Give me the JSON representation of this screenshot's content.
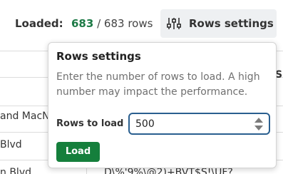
{
  "toolbar": {
    "loaded_label": "Loaded:",
    "loaded_count": "683",
    "loaded_total": "/ 683 rows",
    "rows_settings_label": "Rows settings",
    "settings_icon": "sliders-icon"
  },
  "table": {
    "rows": [
      {
        "col1": "and MacN",
        "col2": ""
      },
      {
        "col1": "Blvd",
        "col2": ""
      },
      {
        "col1": "n Blvd",
        "col2": "D\\%'9%\\@2)+BVT$S!\\UF?"
      }
    ],
    "header_partial": "S"
  },
  "popover": {
    "title": "Rows settings",
    "description": "Enter the number of rows to load. A high number may impact the performance.",
    "rows_to_load_label": "Rows to load",
    "rows_to_load_value": "500",
    "load_button_label": "Load"
  },
  "colors": {
    "accent_green": "#157f3c",
    "count_green": "#1d7a46",
    "input_focus_border": "#2a5f8f"
  }
}
